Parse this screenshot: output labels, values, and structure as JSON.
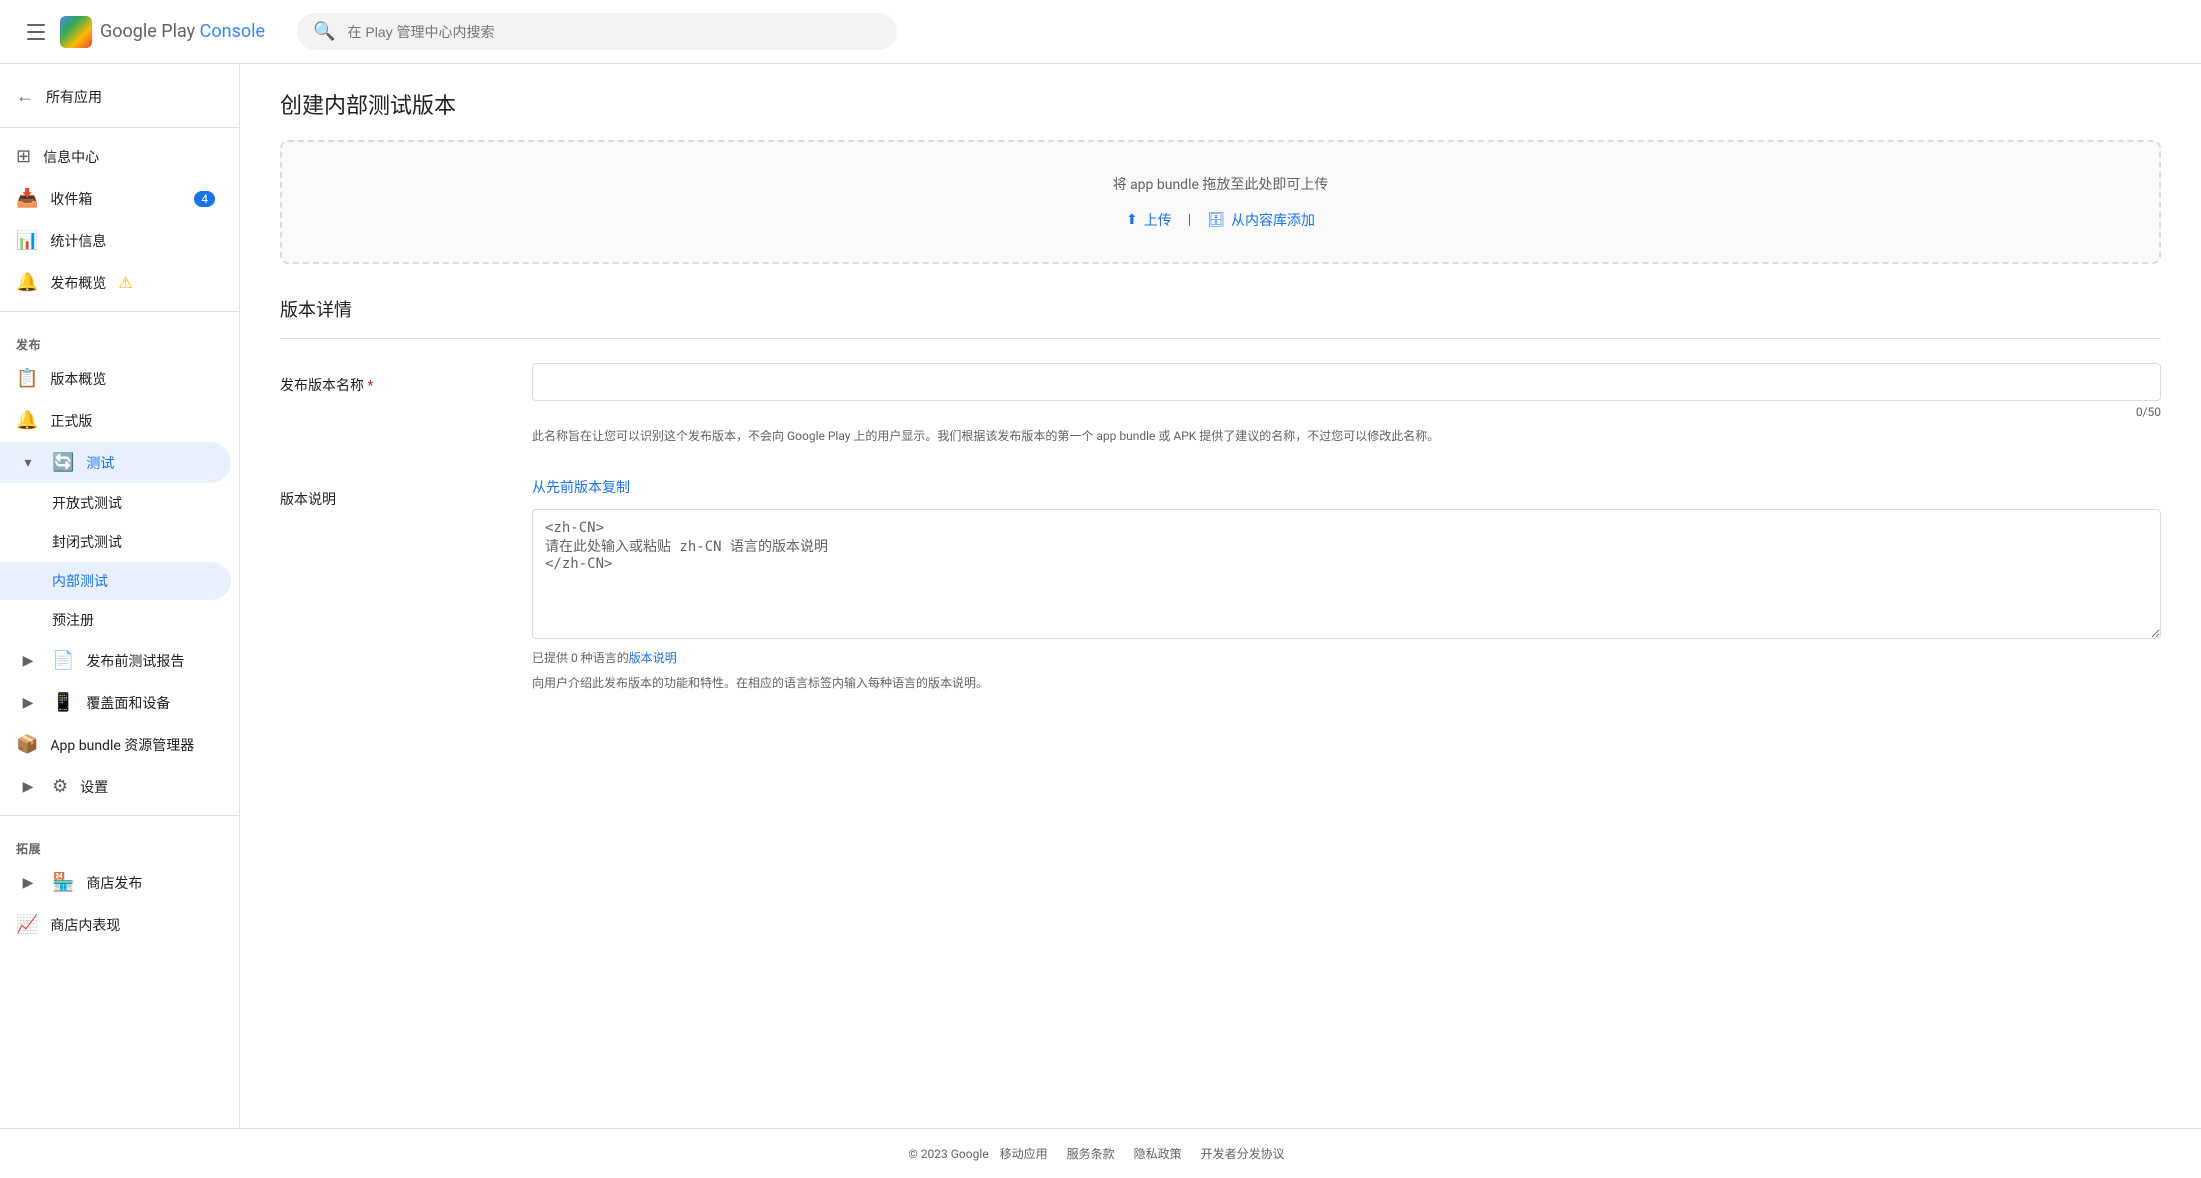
{
  "header": {
    "app_name": "Google Play Console",
    "app_name_colored": "Console",
    "search_placeholder": "在 Play 管理中心内搜索"
  },
  "sidebar": {
    "back_label": "所有应用",
    "sections": [
      {
        "items": [
          {
            "id": "dashboard",
            "label": "信息中心",
            "icon": "grid"
          },
          {
            "id": "inbox",
            "label": "收件箱",
            "icon": "inbox",
            "badge": "4"
          },
          {
            "id": "stats",
            "label": "统计信息",
            "icon": "chart"
          },
          {
            "id": "publish-overview",
            "label": "发布概览",
            "icon": "publish",
            "warning": true
          }
        ]
      },
      {
        "section_label": "发布",
        "items": [
          {
            "id": "version-overview",
            "label": "版本概览",
            "icon": "version"
          },
          {
            "id": "release",
            "label": "正式版",
            "icon": "shield"
          },
          {
            "id": "testing",
            "label": "测试",
            "icon": "testing",
            "active": true,
            "expanded": true
          }
        ],
        "sub_items": [
          {
            "id": "open-test",
            "label": "开放式测试"
          },
          {
            "id": "closed-test",
            "label": "封闭式测试"
          },
          {
            "id": "internal-test",
            "label": "内部测试",
            "active": true
          },
          {
            "id": "pre-register",
            "label": "预注册"
          }
        ],
        "expand_items": [
          {
            "id": "pre-launch-report",
            "label": "发布前测试报告",
            "icon": "report"
          },
          {
            "id": "coverage-devices",
            "label": "覆盖面和设备",
            "icon": "devices"
          },
          {
            "id": "app-bundle",
            "label": "App bundle 资源管理器",
            "icon": "bundle"
          },
          {
            "id": "settings",
            "label": "设置",
            "icon": "settings"
          }
        ]
      },
      {
        "section_label": "拓展",
        "items": [
          {
            "id": "store-publish",
            "label": "商店发布",
            "icon": "store"
          },
          {
            "id": "store-display",
            "label": "商店内表现",
            "icon": "extend"
          }
        ]
      }
    ]
  },
  "main": {
    "page_title": "创建内部测试版本",
    "upload": {
      "hint": "将 app bundle 拖放至此处即可上传",
      "upload_label": "上传",
      "library_label": "从内容库添加"
    },
    "release_details_title": "版本详情",
    "release_name": {
      "label": "发布版本名称",
      "required": true,
      "value": "",
      "char_count": "0/50",
      "hint": "此名称旨在让您可以识别这个发布版本，不会向 Google Play 上的用户显示。我们根据该发布版本的第一个 app bundle 或 APK 提供了建议的名称，不过您可以修改此名称。"
    },
    "release_notes": {
      "label": "版本说明",
      "copy_label": "从先前版本复制",
      "placeholder": "<zh-CN>\n请在此处输入或粘贴 zh-CN 语言的版本说明\n</zh-CN>",
      "status": "已提供 0 种语言的版本说明",
      "status_link": "版本说明",
      "desc": "向用户介绍此发布版本的功能和特性。在相应的语言标签内输入每种语言的版本说明。"
    }
  },
  "footer": {
    "copyright": "© 2023 Google",
    "links": [
      "移动应用",
      "服务条款",
      "隐私政策",
      "开发者分发协议"
    ]
  }
}
